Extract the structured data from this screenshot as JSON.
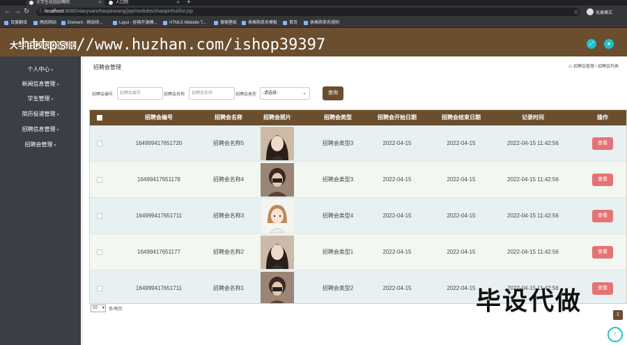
{
  "browser": {
    "tab1_title": "大学生校园招聘网",
    "tab2_title": "人口网",
    "url_host": "localhost",
    "url_path": ":8080/xiaoyuanzhaopinwang/jsp/modules/zhaopinhui/list.jsp",
    "profile_label": "无痕模式",
    "bookmarks": [
      "百度翻译",
      "雨后网站",
      "Element - 网站快...",
      "Layui - 经典开源模...",
      "HTML5 Website T...",
      "搜索壁纸",
      "表格购单名模板",
      "首页",
      "表格购单名规则"
    ]
  },
  "header": {
    "title": "大学生校园招聘网"
  },
  "sidebar": {
    "items": [
      {
        "label": "个人中心"
      },
      {
        "label": "新闻信息管理"
      },
      {
        "label": "学生管理"
      },
      {
        "label": "简历投递管理"
      },
      {
        "label": "招聘信息管理"
      },
      {
        "label": "招聘会管理"
      }
    ]
  },
  "page": {
    "title": "招聘会管理",
    "breadcrumb": "招聘会管理 / 招聘会列表"
  },
  "filters": {
    "number_label": "招聘会编号",
    "number_placeholder": "招聘会编号",
    "name_label": "招聘会名称",
    "name_placeholder": "招聘会名称",
    "type_label": "招聘会类型",
    "type_selected": "-请选择-",
    "search_label": "查询"
  },
  "table": {
    "headers": [
      "招聘会编号",
      "招聘会名称",
      "招聘会照片",
      "招聘会类型",
      "招聘会开始日期",
      "招聘会结束日期",
      "记录时间",
      "操作"
    ],
    "rows": [
      {
        "number": "164999417651720",
        "name": "招聘会名称5",
        "type": "招聘会类型3",
        "start": "2022-04-15",
        "end": "2022-04-15",
        "time": "2022-04-15 11:42:56",
        "action": "查看"
      },
      {
        "number": "16499417651178",
        "name": "招聘会名称4",
        "type": "招聘会类型3",
        "start": "2022-04-15",
        "end": "2022-04-15",
        "time": "2022-04-15 11:42:56",
        "action": "查看"
      },
      {
        "number": "164999417651711",
        "name": "招聘会名称3",
        "type": "招聘会类型4",
        "start": "2022-04-15",
        "end": "2022-04-15",
        "time": "2022-04-15 11:42:56",
        "action": "查看"
      },
      {
        "number": "16499417651177",
        "name": "招聘会名称2",
        "type": "招聘会类型1",
        "start": "2022-04-15",
        "end": "2022-04-15",
        "time": "2022-04-15 11:42:56",
        "action": "查看"
      },
      {
        "number": "164999417651711",
        "name": "招聘会名称1",
        "type": "招聘会类型2",
        "start": "2022-04-15",
        "end": "2022-04-15",
        "time": "2022-04-15 11:42:56",
        "action": "查看"
      }
    ]
  },
  "pagination": {
    "page_size": "10",
    "page_size_label": "条/每页",
    "current_page": "1"
  },
  "watermark": {
    "url": "https://www.huzhan.com/ishop39397",
    "text": "毕设代做"
  },
  "colors": {
    "brand": "#6b4e2e",
    "accent": "#1ec2c8",
    "danger": "#e57373",
    "sidebar": "#3a3f46"
  }
}
